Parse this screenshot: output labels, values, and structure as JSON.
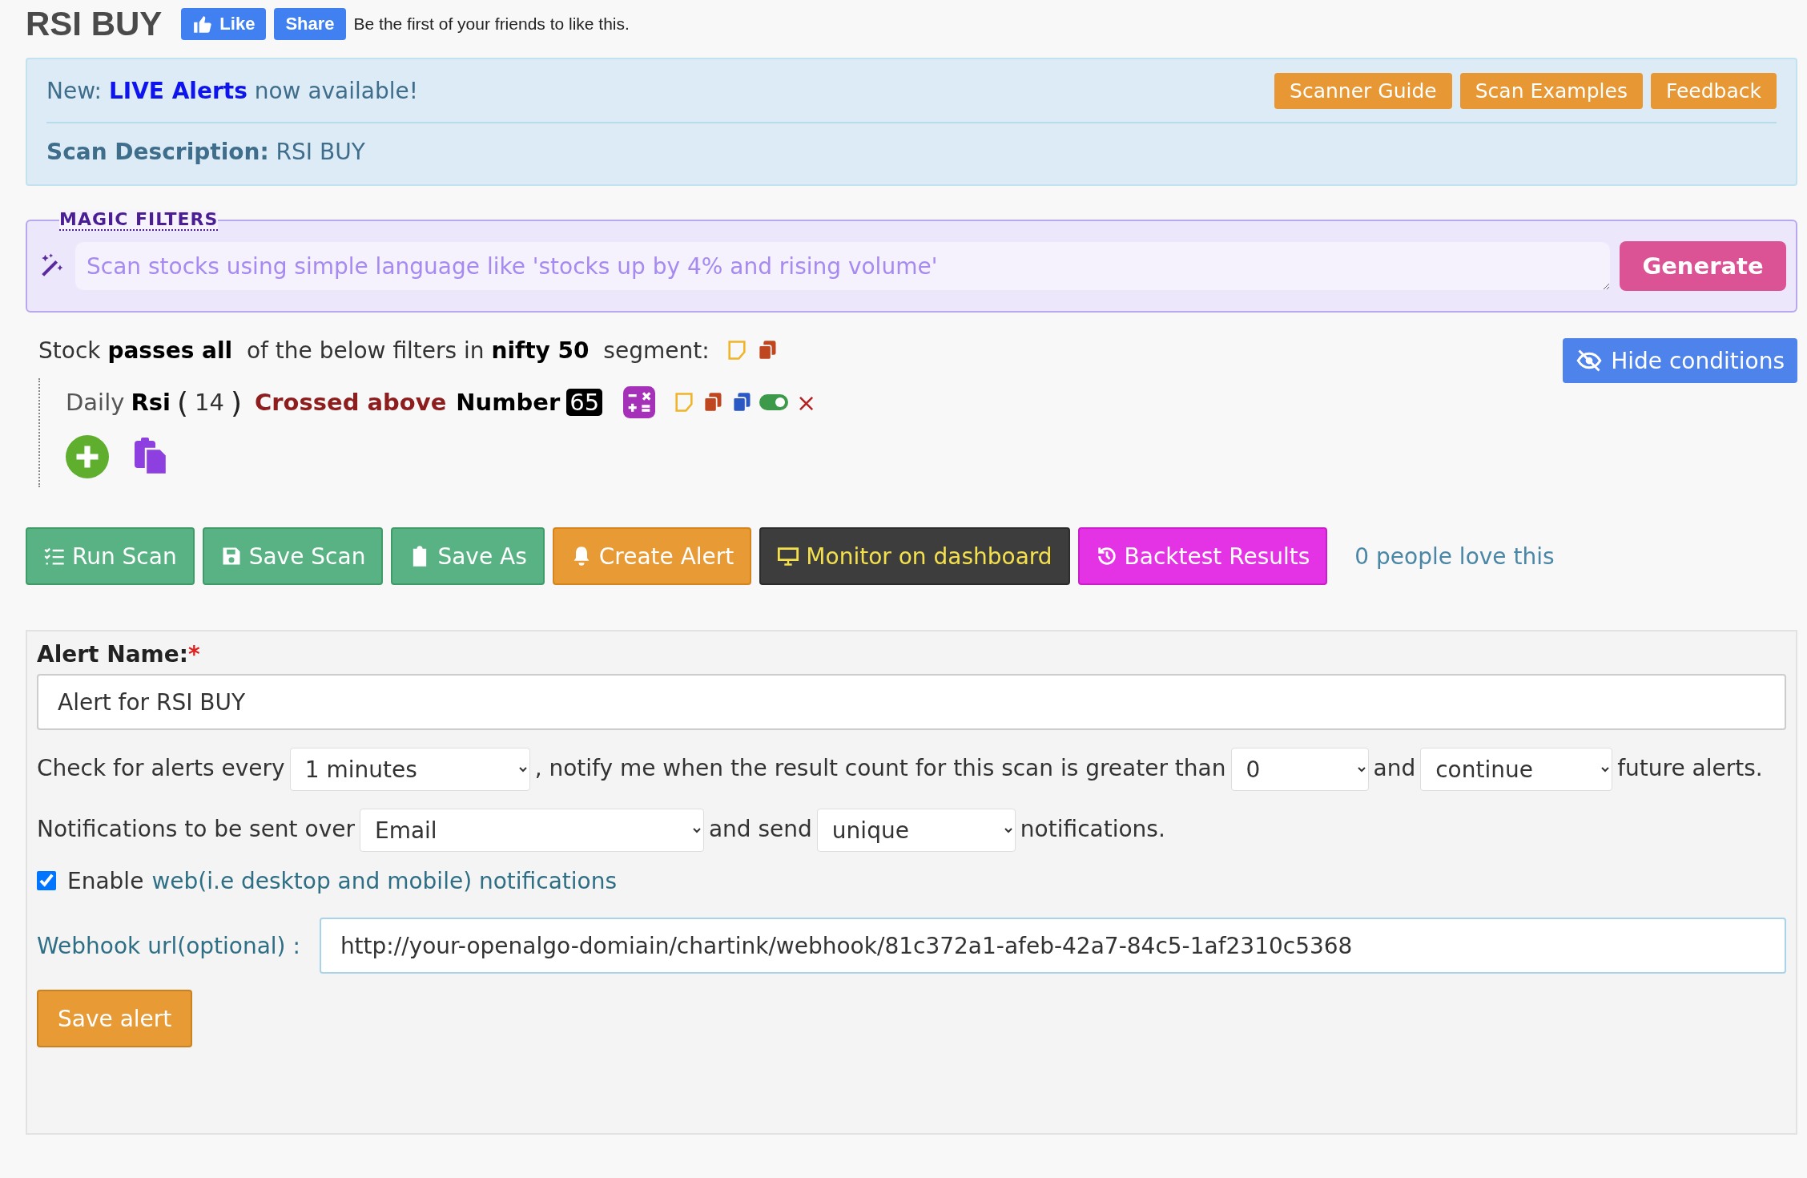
{
  "header": {
    "title": "RSI BUY",
    "like_button": "Like",
    "share_button": "Share",
    "social_text": "Be the first of your friends to like this."
  },
  "info_box": {
    "announcement_prefix": "New:",
    "announcement_link": "LIVE Alerts",
    "announcement_suffix": "now available!",
    "buttons": [
      "Scanner Guide",
      "Scan Examples",
      "Feedback"
    ],
    "description_label": "Scan Description:",
    "description": "RSI BUY"
  },
  "magic_filters": {
    "legend": "MAGIC FILTERS",
    "placeholder": "Scan stocks using simple language like 'stocks up by 4% and rising volume'",
    "button": "Generate"
  },
  "conditions": {
    "summary": "Stock **passes all**  of the below filters in **nifty 50**  segment:",
    "hide_button": "Hide conditions",
    "filters": [
      {
        "timeframe": "Daily",
        "indicator": "Rsi",
        "open_paren": "(",
        "param": "14",
        "close_paren": ")",
        "operator": "Crossed above",
        "operand": "Number",
        "value": "65",
        "enabled": true,
        "remove": "×"
      }
    ]
  },
  "actions": [
    {
      "kind": "run",
      "label": "Run Scan"
    },
    {
      "kind": "save",
      "label": "Save Scan"
    },
    {
      "kind": "save_as",
      "label": "Save As"
    },
    {
      "kind": "alert",
      "label": "Create Alert"
    },
    {
      "kind": "monitor",
      "label": "Monitor on dashboard"
    },
    {
      "kind": "backtest",
      "label": "Backtest Results"
    }
  ],
  "love_text": "0 people love this",
  "alert_form": {
    "name_label": "Alert Name:",
    "required_mark": "*",
    "name_value": "Alert for RSI BUY",
    "check_prefix": "Check for alerts every",
    "interval": "1 minutes",
    "check_middle": ", notify me when the result count for this scan is greater than",
    "threshold": "0",
    "check_and": "and",
    "mode": "continue",
    "check_suffix": "future alerts.",
    "notify_prefix": "Notifications to be sent over",
    "channel": "Email",
    "notify_middle": "and send",
    "frequency": "unique",
    "notify_suffix": "notifications.",
    "web_enabled": true,
    "web_label": "Enable",
    "web_link": "web(i.e desktop and mobile) notifications",
    "webhook_label": "Webhook url(optional) :",
    "webhook_value": "http://your-openalgo-domiain/chartink/webhook/81c372a1-afeb-42a7-84c5-1af2310c5368",
    "save_button": "Save alert"
  }
}
